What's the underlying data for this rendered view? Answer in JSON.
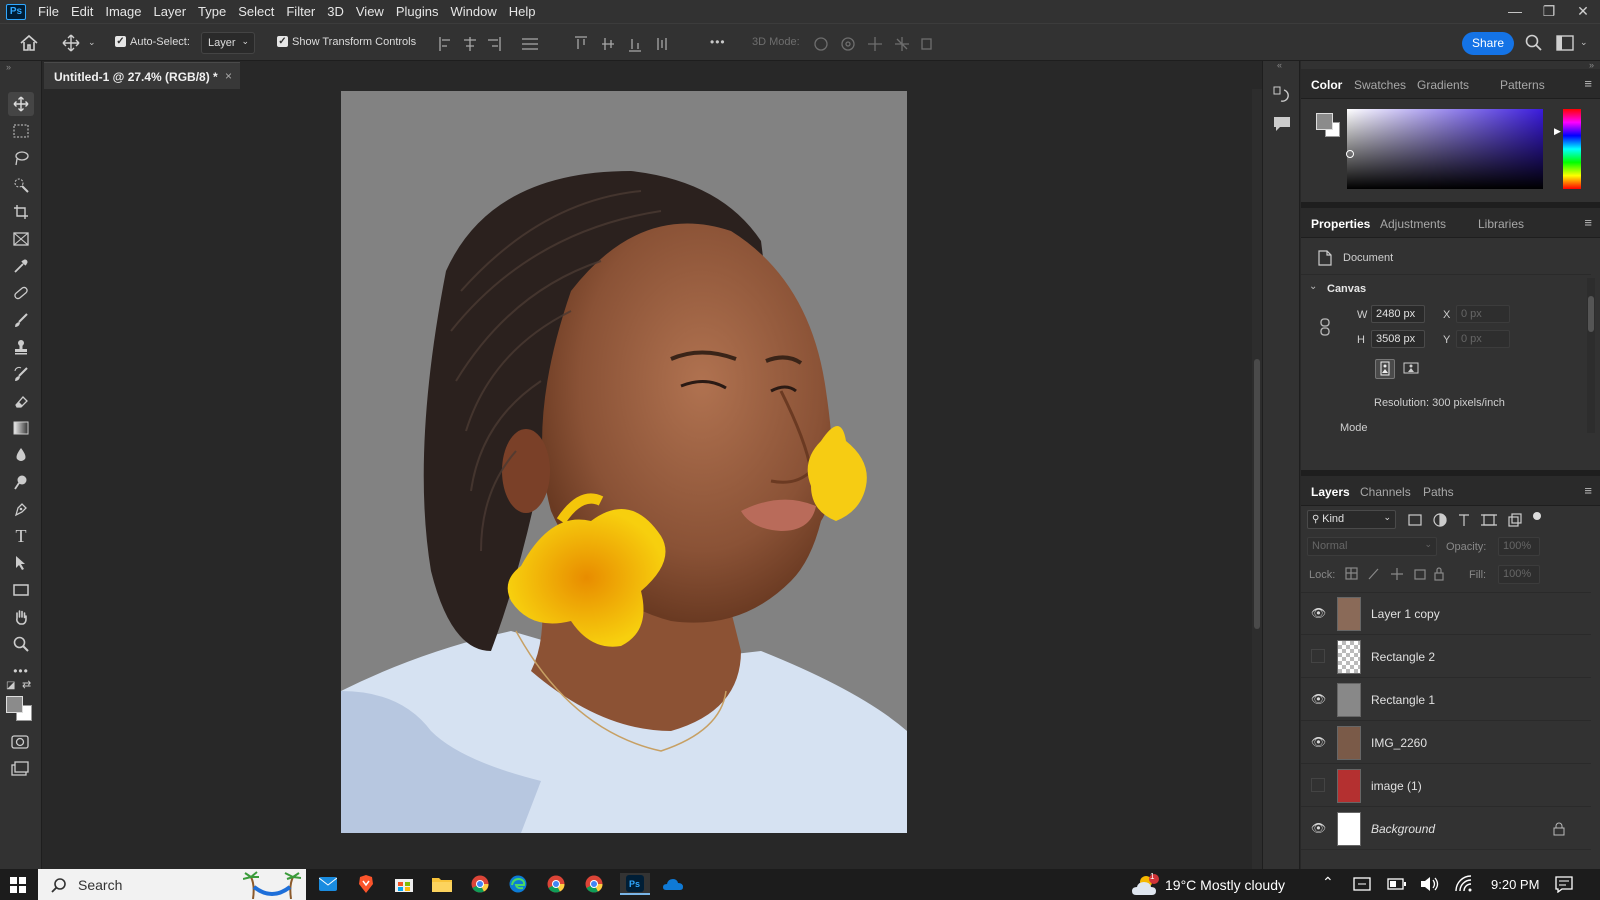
{
  "app": {
    "logo": "Ps"
  },
  "menu": [
    "File",
    "Edit",
    "Image",
    "Layer",
    "Type",
    "Select",
    "Filter",
    "3D",
    "View",
    "Plugins",
    "Window",
    "Help"
  ],
  "window_controls": {
    "minimize": "—",
    "restore": "❐",
    "close": "✕"
  },
  "options": {
    "auto_select_label": "Auto-Select:",
    "auto_select_target": "Layer",
    "show_transform_label": "Show Transform Controls",
    "more": "•••",
    "mode_3d_label": "3D Mode:",
    "share_label": "Share"
  },
  "document": {
    "tab_title": "Untitled-1 @ 27.4% (RGB/8) *",
    "tab_close": "×"
  },
  "tools": [
    "move-tool",
    "rectangular-marquee-tool",
    "lasso-tool",
    "quick-selection-tool",
    "crop-tool",
    "frame-tool",
    "eyedropper-tool",
    "healing-brush-tool",
    "brush-tool",
    "clone-stamp-tool",
    "history-brush-tool",
    "eraser-tool",
    "gradient-tool",
    "blur-tool",
    "dodge-tool",
    "pen-tool",
    "type-tool",
    "path-selection-tool",
    "rectangle-tool",
    "hand-tool",
    "zoom-tool",
    "more-tools"
  ],
  "color_panel": {
    "tabs": [
      "Color",
      "Swatches",
      "Gradients",
      "Patterns"
    ],
    "active_tab": "Color",
    "hue_color": "#3a1bdc"
  },
  "properties_panel": {
    "tabs": [
      "Properties",
      "Adjustments",
      "Libraries"
    ],
    "active_tab": "Properties",
    "doc_label": "Document",
    "canvas_label": "Canvas",
    "w_label": "W",
    "w_value": "2480 px",
    "h_label": "H",
    "h_value": "3508 px",
    "x_label": "X",
    "x_value": "0 px",
    "y_label": "Y",
    "y_value": "0 px",
    "resolution": "Resolution: 300 pixels/inch",
    "mode_label": "Mode"
  },
  "layers_panel": {
    "tabs": [
      "Layers",
      "Channels",
      "Paths"
    ],
    "active_tab": "Layers",
    "filter_kind": "Kind",
    "blend_mode": "Normal",
    "opacity_label": "Opacity:",
    "opacity_value": "100%",
    "lock_label": "Lock:",
    "fill_label": "Fill:",
    "fill_value": "100%",
    "layers": [
      {
        "name": "Layer 1 copy",
        "visible": true
      },
      {
        "name": "Rectangle 2",
        "visible": false
      },
      {
        "name": "Rectangle 1",
        "visible": true
      },
      {
        "name": "IMG_2260",
        "visible": true
      },
      {
        "name": "image (1)",
        "visible": false
      },
      {
        "name": "Background",
        "visible": true,
        "locked": true
      }
    ]
  },
  "taskbar": {
    "search_placeholder": "Search",
    "weather": "19°C  Mostly cloudy",
    "time": "9:20 PM",
    "weather_badge": "1"
  }
}
